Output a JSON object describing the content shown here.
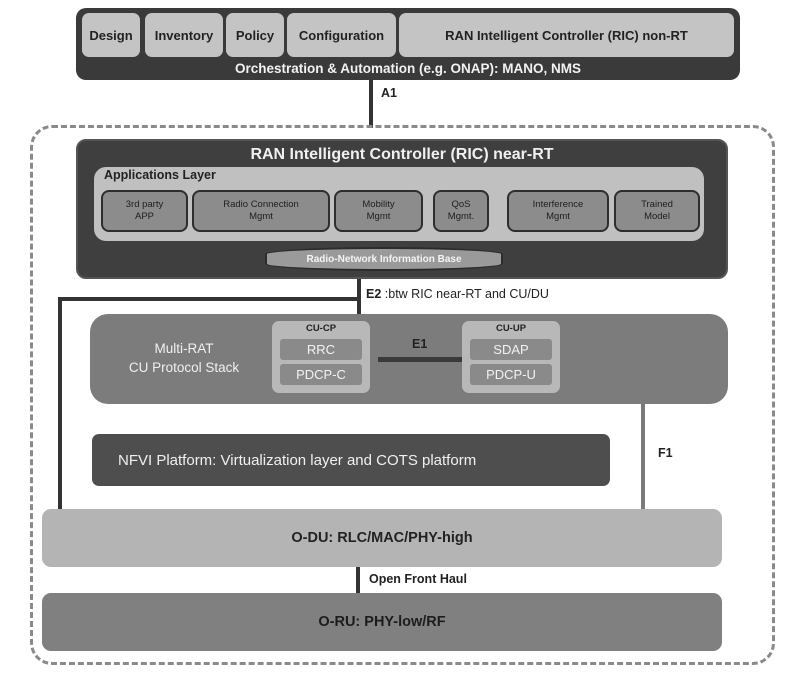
{
  "orchestration": {
    "tabs": [
      "Design",
      "Inventory",
      "Policy",
      "Configuration",
      "RAN Intelligent Controller (RIC) non-RT"
    ],
    "label": "Orchestration & Automation (e.g. ONAP): MANO, NMS"
  },
  "interfaces": {
    "a1": "A1",
    "e2_name": "E2",
    "e2_desc": " :btw RIC near-RT and CU/DU",
    "e1": "E1",
    "f1": "F1",
    "fronthaul": "Open Front Haul"
  },
  "ric_near_rt": {
    "title": "RAN Intelligent Controller (RIC) near-RT",
    "apps_layer": "Applications Layer",
    "apps": [
      {
        "line1": "3rd party",
        "line2": "APP"
      },
      {
        "line1": "Radio Connection",
        "line2": "Mgmt"
      },
      {
        "line1": "Mobility",
        "line2": "Mgmt"
      },
      {
        "line1": "QoS",
        "line2": "Mgmt."
      },
      {
        "line1": "Interference",
        "line2": "Mgmt"
      },
      {
        "line1": "Trained",
        "line2": "Model"
      }
    ],
    "rnib": "Radio-Network Information Base"
  },
  "cu": {
    "label_line1": "Multi-RAT",
    "label_line2": "CU Protocol Stack",
    "cu_cp": {
      "title": "CU-CP",
      "layers": [
        "RRC",
        "PDCP-C"
      ]
    },
    "cu_up": {
      "title": "CU-UP",
      "layers": [
        "SDAP",
        "PDCP-U"
      ]
    }
  },
  "nfvi": "NFVI Platform: Virtualization layer and COTS platform",
  "odu": "O-DU: RLC/MAC/PHY-high",
  "oru": "O-RU: PHY-low/RF"
}
